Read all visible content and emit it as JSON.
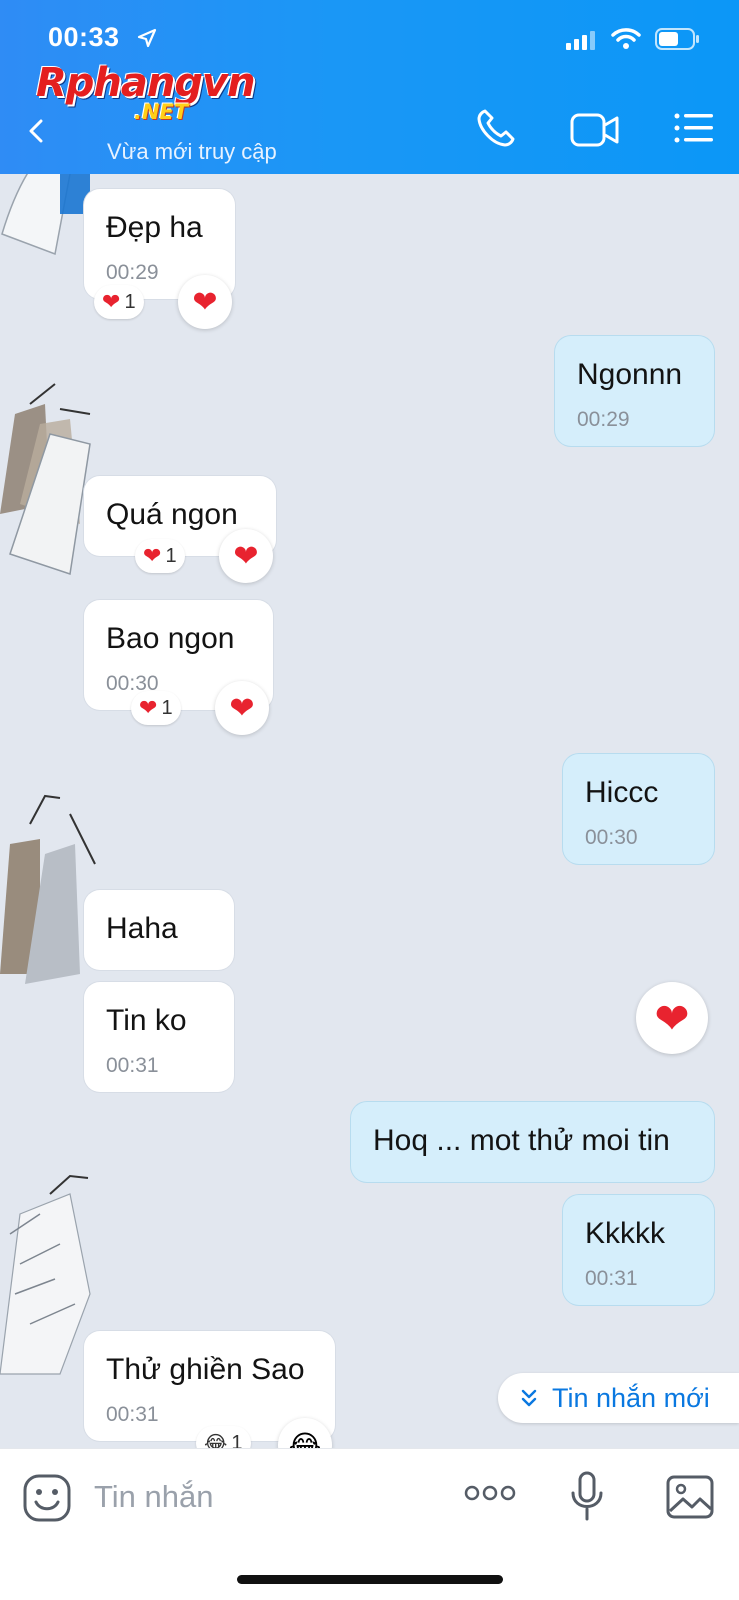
{
  "status_bar": {
    "time": "00:33"
  },
  "header": {
    "logo_main": "Rphangvn",
    "logo_sub": ".NET",
    "subtitle": "Vừa mới truy cập"
  },
  "messages": [
    {
      "dir": "in",
      "text": "Đẹp ha",
      "time": "00:29",
      "reaction": "❤",
      "reaction_count": "1"
    },
    {
      "dir": "out",
      "text": "Ngonnn",
      "time": "00:29"
    },
    {
      "dir": "in",
      "text": "Quá ngon",
      "time": "",
      "reaction": "❤",
      "reaction_count": "1"
    },
    {
      "dir": "in",
      "text": "Bao ngon",
      "time": "00:30",
      "reaction": "❤",
      "reaction_count": "1"
    },
    {
      "dir": "out",
      "text": "Hiccc",
      "time": "00:30"
    },
    {
      "dir": "in",
      "text": "Haha",
      "time": ""
    },
    {
      "dir": "in",
      "text": "Tin ko",
      "time": "00:31"
    },
    {
      "dir": "out",
      "text": "Hoq ... mot thử moi tin",
      "time": ""
    },
    {
      "dir": "out",
      "text": "Kkkkk",
      "time": "00:31"
    },
    {
      "dir": "in",
      "text": "Thử ghiền Sao",
      "time": "00:31",
      "reaction": "😂",
      "reaction_count": "1"
    }
  ],
  "new_messages_button": "Tin nhắn mới",
  "input": {
    "placeholder": "Tin nhắn"
  },
  "icons": [
    "location-arrow-icon",
    "signal-icon",
    "wifi-icon",
    "battery-icon",
    "back-icon",
    "phone-icon",
    "video-icon",
    "menu-icon",
    "heart-icon",
    "laugh-icon",
    "chevron-double-down-icon",
    "emoji-icon",
    "more-icon",
    "mic-icon",
    "image-icon"
  ],
  "colors": {
    "header": "#1a97f6",
    "chat_bg": "#e2e7ef",
    "outgoing": "#d5eefb",
    "incoming": "#ffffff",
    "accent": "#0a78e0",
    "heart": "#e8232f"
  }
}
